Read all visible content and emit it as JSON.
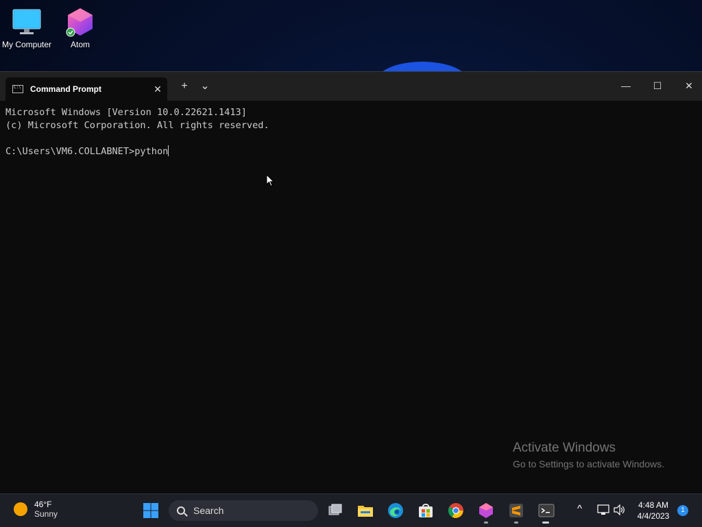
{
  "desktop": {
    "icons": [
      {
        "label": "My Computer"
      },
      {
        "label": "Atom"
      }
    ]
  },
  "window": {
    "tab_title": "Command Prompt",
    "tab_close": "✕",
    "new_tab": "+",
    "dropdown": "⌄",
    "minimize": "—",
    "maximize": "☐",
    "close": "✕"
  },
  "terminal": {
    "lines": [
      "Microsoft Windows [Version 10.0.22621.1413]",
      "(c) Microsoft Corporation. All rights reserved.",
      "",
      "C:\\Users\\VM6.COLLABNET>python"
    ]
  },
  "watermark": {
    "line1": "Activate Windows",
    "line2": "Go to Settings to activate Windows."
  },
  "taskbar": {
    "weather_temp": "46°F",
    "weather_desc": "Sunny",
    "search_label": "Search",
    "clock_time": "4:48 AM",
    "clock_date": "4/4/2023",
    "notification_count": "1",
    "tray_chevron": "^"
  },
  "colors": {
    "terminal_bg": "#0c0c0c",
    "terminal_fg": "#cccccc",
    "taskbar_bg": "#1c1f26",
    "accent": "#2a8df0"
  }
}
